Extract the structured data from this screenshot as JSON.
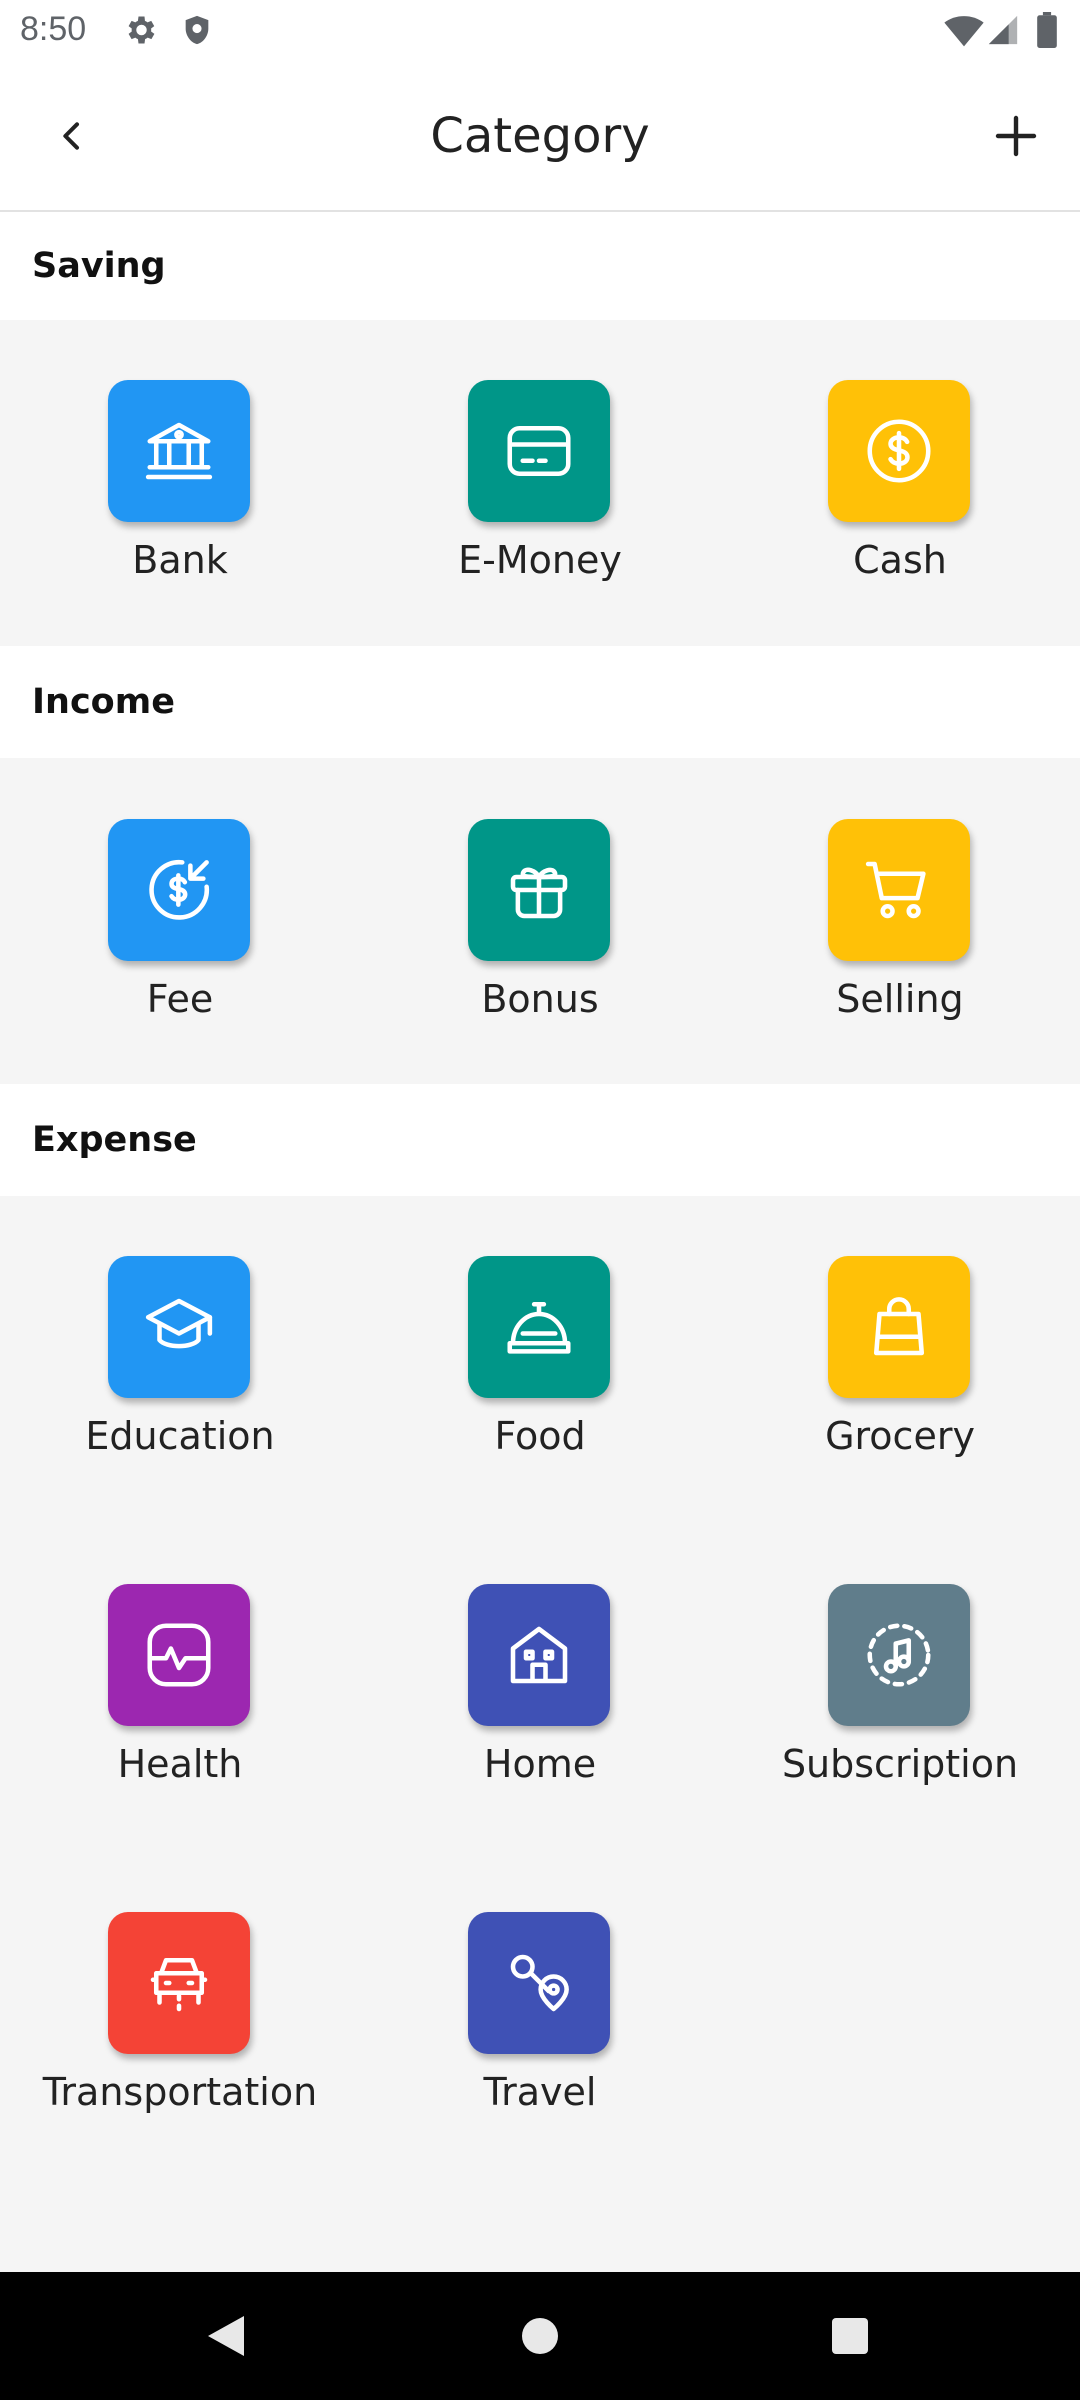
{
  "status_bar": {
    "time": "8:50"
  },
  "header": {
    "title": "Category"
  },
  "sections": [
    {
      "title": "Saving",
      "items": [
        {
          "label": "Bank",
          "icon": "bank-icon",
          "color": "#2196F3"
        },
        {
          "label": "E-Money",
          "icon": "card-icon",
          "color": "#009688"
        },
        {
          "label": "Cash",
          "icon": "dollar-circle-icon",
          "color": "#FFC107"
        }
      ]
    },
    {
      "title": "Income",
      "items": [
        {
          "label": "Fee",
          "icon": "fee-icon",
          "color": "#2196F3"
        },
        {
          "label": "Bonus",
          "icon": "gift-icon",
          "color": "#009688"
        },
        {
          "label": "Selling",
          "icon": "cart-icon",
          "color": "#FFC107"
        }
      ]
    },
    {
      "title": "Expense",
      "items": [
        {
          "label": "Education",
          "icon": "graduation-cap-icon",
          "color": "#2196F3"
        },
        {
          "label": "Food",
          "icon": "food-bell-icon",
          "color": "#009688"
        },
        {
          "label": "Grocery",
          "icon": "shopping-bag-icon",
          "color": "#FFC107"
        },
        {
          "label": "Health",
          "icon": "heartbeat-icon",
          "color": "#9C27B0"
        },
        {
          "label": "Home",
          "icon": "house-icon",
          "color": "#3F51B5"
        },
        {
          "label": "Subscription",
          "icon": "music-icon",
          "color": "#607D8B"
        },
        {
          "label": "Transportation",
          "icon": "car-icon",
          "color": "#F44336"
        },
        {
          "label": "Travel",
          "icon": "route-icon",
          "color": "#3F51B5"
        }
      ]
    }
  ]
}
